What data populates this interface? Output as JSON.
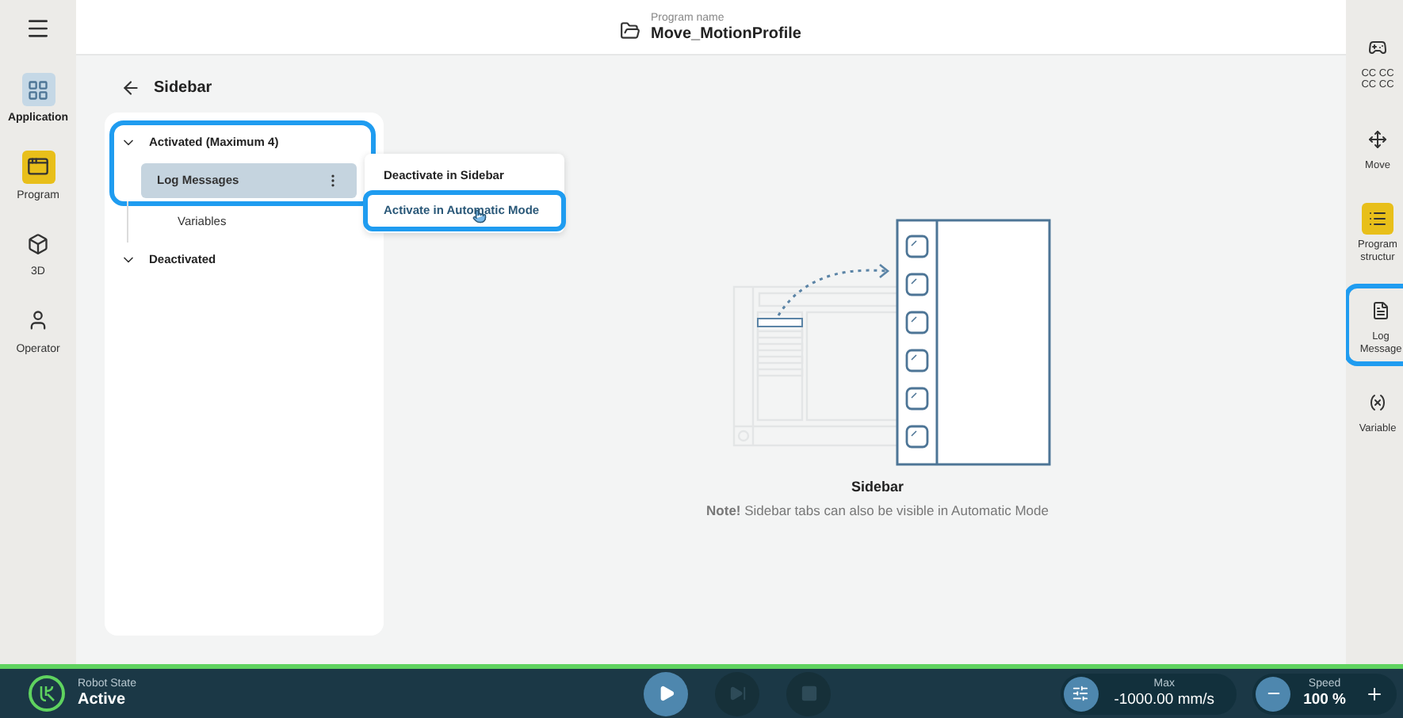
{
  "header": {
    "program_label": "Program name",
    "program_name": "Move_MotionProfile"
  },
  "nav": [
    {
      "kind": "application",
      "label": "Application",
      "selected": true
    },
    {
      "kind": "program",
      "label": "Program",
      "selected": false,
      "color": "#e8bf1a"
    },
    {
      "kind": "cube",
      "label": "3D",
      "selected": false
    },
    {
      "kind": "operator",
      "label": "Operator",
      "selected": false
    }
  ],
  "page": {
    "title": "Sidebar"
  },
  "tree": [
    {
      "label": "Activated (Maximum 4)",
      "expanded": true,
      "highlighted": true,
      "children": [
        {
          "label": "Log Messages",
          "selected": true,
          "highlighted": true
        },
        {
          "label": "Variables",
          "selected": false,
          "highlighted": false
        }
      ]
    },
    {
      "label": "Deactivated",
      "expanded": true,
      "highlighted": false
    }
  ],
  "context_menu": [
    {
      "label": "Deactivate in Sidebar",
      "highlighted": false
    },
    {
      "label": "Activate in Automatic Mode",
      "highlighted": true
    }
  ],
  "illustration": {
    "title": "Sidebar",
    "note": "**Note!** Sidebar tabs can also be visible in Automatic Mode"
  },
  "right_bar": [
    {
      "kind": "pendant",
      "lines": [
        "CC CC",
        "CC CC"
      ],
      "highlighted": false
    },
    {
      "kind": "move",
      "lines": [
        "Move"
      ],
      "highlighted": false
    },
    {
      "kind": "structure",
      "lines": [
        "Program",
        "structur"
      ],
      "highlighted": false,
      "color": "#e8bf1a"
    },
    {
      "kind": "log",
      "lines": [
        "Log",
        "Message"
      ],
      "highlighted": true
    },
    {
      "kind": "variables",
      "lines": [
        "Variable"
      ],
      "highlighted": false
    }
  ],
  "status": {
    "label": "Robot State",
    "value": "Active",
    "max_label": "Max",
    "max_value": "-1000.00 mm/s",
    "speed_label": "Speed",
    "speed_value": "100 %"
  },
  "controls": [
    {
      "kind": "play",
      "disabled": false
    },
    {
      "kind": "step",
      "disabled": true
    },
    {
      "kind": "stop",
      "disabled": true
    }
  ]
}
